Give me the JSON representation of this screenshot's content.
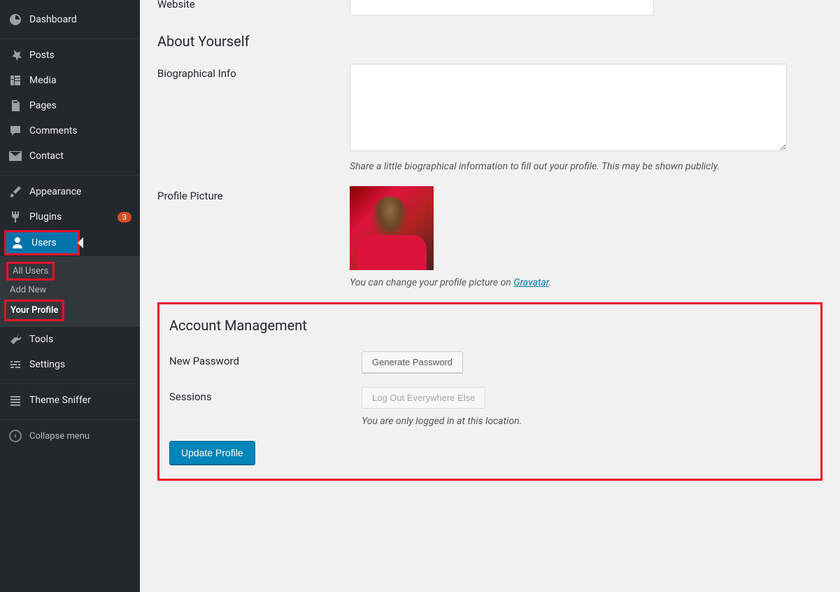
{
  "sidebar": {
    "items": [
      {
        "label": "Dashboard",
        "icon": "dashboard"
      },
      {
        "label": "Posts",
        "icon": "pin"
      },
      {
        "label": "Media",
        "icon": "media"
      },
      {
        "label": "Pages",
        "icon": "pages"
      },
      {
        "label": "Comments",
        "icon": "comment"
      },
      {
        "label": "Contact",
        "icon": "envelope"
      },
      {
        "label": "Appearance",
        "icon": "brush"
      },
      {
        "label": "Plugins",
        "icon": "plug",
        "badge": "3"
      },
      {
        "label": "Users",
        "icon": "user",
        "active": true
      },
      {
        "label": "Tools",
        "icon": "wrench"
      },
      {
        "label": "Settings",
        "icon": "sliders"
      },
      {
        "label": "Theme Sniffer",
        "icon": "list"
      }
    ],
    "submenu": [
      {
        "label": "All Users"
      },
      {
        "label": "Add New"
      },
      {
        "label": "Your Profile",
        "current": true
      }
    ],
    "collapse": "Collapse menu"
  },
  "profile": {
    "website_label": "Website",
    "about_heading": "About Yourself",
    "bio_label": "Biographical Info",
    "bio_description": "Share a little biographical information to fill out your profile. This may be shown publicly.",
    "avatar_label": "Profile Picture",
    "avatar_description_prefix": "You can change your profile picture on ",
    "avatar_link_text": "Gravatar",
    "avatar_description_suffix": ".",
    "account_heading": "Account Management",
    "password_label": "New Password",
    "generate_button": "Generate Password",
    "sessions_label": "Sessions",
    "logout_button": "Log Out Everywhere Else",
    "sessions_description": "You are only logged in at this location.",
    "submit_button": "Update Profile"
  }
}
